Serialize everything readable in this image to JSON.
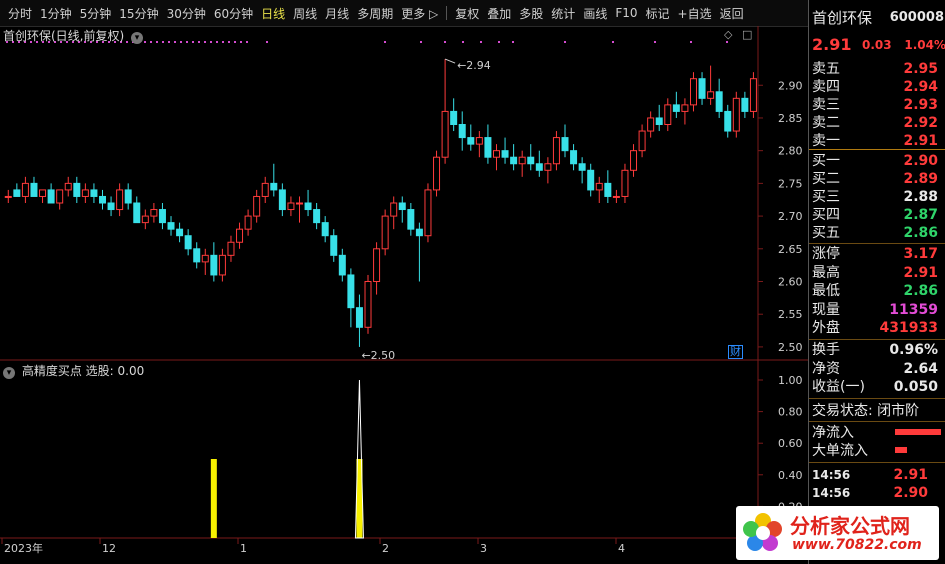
{
  "toolbar": {
    "items": [
      "分时",
      "1分钟",
      "5分钟",
      "15分钟",
      "30分钟",
      "60分钟",
      "日线",
      "周线",
      "月线",
      "多周期",
      "更多 ▷",
      "复权",
      "叠加",
      "多股",
      "统计",
      "画线",
      "F10",
      "标记",
      "+自选",
      "返回"
    ],
    "active_index": 6
  },
  "main_chart": {
    "title": "首创环保(日线,前复权)",
    "cai_badge": "财",
    "high_annotation": "2.94",
    "low_annotation": "2.50"
  },
  "indicator": {
    "title": "高精度买点 选股: 0.00"
  },
  "x_axis": {
    "labels": [
      "2023年",
      "12",
      "1",
      "2",
      "3",
      "4"
    ]
  },
  "right_panel": {
    "stock_name": "首创环保",
    "stock_code": "600008",
    "price": "2.91",
    "change": "0.03",
    "change_pct": "1.04%",
    "sell": [
      {
        "label": "卖五",
        "price": "2.95"
      },
      {
        "label": "卖四",
        "price": "2.94"
      },
      {
        "label": "卖三",
        "price": "2.93"
      },
      {
        "label": "卖二",
        "price": "2.92"
      },
      {
        "label": "卖一",
        "price": "2.91"
      }
    ],
    "buy": [
      {
        "label": "买一",
        "price": "2.90"
      },
      {
        "label": "买二",
        "price": "2.89"
      },
      {
        "label": "买三",
        "price": "2.88"
      },
      {
        "label": "买四",
        "price": "2.87"
      },
      {
        "label": "买五",
        "price": "2.86"
      }
    ],
    "stats": [
      {
        "label": "涨停",
        "value": "3.17"
      },
      {
        "label": "最高",
        "value": "2.91"
      },
      {
        "label": "最低",
        "value": "2.86"
      },
      {
        "label": "现量",
        "value": "11359"
      },
      {
        "label": "外盘",
        "value": "431933"
      }
    ],
    "extra": [
      {
        "label": "换手",
        "value": "0.96%"
      },
      {
        "label": "净资",
        "value": "2.64"
      },
      {
        "label": "收益(一)",
        "value": "0.050"
      }
    ],
    "trade_status": "交易状态: 闭市阶",
    "net_inflow": "净流入",
    "big_inflow": "大单流入",
    "ticks": [
      {
        "time": "14:56",
        "price": "2.91"
      },
      {
        "time": "14:56",
        "price": "2.90"
      }
    ]
  },
  "watermark": {
    "name": "分析家公式网",
    "url": "www.70822.com"
  },
  "colors": {
    "up": "#ff3b3b",
    "down": "#38e0e8",
    "signal": "#f7f000",
    "grid": "#7a1a1a"
  },
  "chart_data": [
    {
      "type": "candlestick",
      "title": "首创环保(日线,前复权)",
      "y_range": [
        2.48,
        2.96
      ],
      "y_ticks": [
        2.5,
        2.55,
        2.6,
        2.65,
        2.7,
        2.75,
        2.8,
        2.85,
        2.9
      ],
      "ohlc": [
        [
          2.73,
          2.74,
          2.72,
          2.73
        ],
        [
          2.74,
          2.75,
          2.73,
          2.73
        ],
        [
          2.73,
          2.76,
          2.72,
          2.75
        ],
        [
          2.75,
          2.76,
          2.73,
          2.73
        ],
        [
          2.73,
          2.74,
          2.72,
          2.74
        ],
        [
          2.74,
          2.75,
          2.73,
          2.72
        ],
        [
          2.72,
          2.74,
          2.71,
          2.74
        ],
        [
          2.74,
          2.76,
          2.73,
          2.75
        ],
        [
          2.75,
          2.76,
          2.72,
          2.73
        ],
        [
          2.73,
          2.75,
          2.72,
          2.74
        ],
        [
          2.74,
          2.75,
          2.72,
          2.73
        ],
        [
          2.73,
          2.74,
          2.71,
          2.72
        ],
        [
          2.72,
          2.73,
          2.7,
          2.71
        ],
        [
          2.71,
          2.75,
          2.7,
          2.74
        ],
        [
          2.74,
          2.75,
          2.71,
          2.72
        ],
        [
          2.72,
          2.73,
          2.69,
          2.69
        ],
        [
          2.69,
          2.71,
          2.68,
          2.7
        ],
        [
          2.7,
          2.72,
          2.69,
          2.71
        ],
        [
          2.71,
          2.72,
          2.68,
          2.69
        ],
        [
          2.69,
          2.7,
          2.67,
          2.68
        ],
        [
          2.68,
          2.69,
          2.66,
          2.67
        ],
        [
          2.67,
          2.68,
          2.64,
          2.65
        ],
        [
          2.65,
          2.66,
          2.62,
          2.63
        ],
        [
          2.63,
          2.65,
          2.61,
          2.64
        ],
        [
          2.64,
          2.66,
          2.6,
          2.61
        ],
        [
          2.61,
          2.65,
          2.6,
          2.64
        ],
        [
          2.64,
          2.67,
          2.63,
          2.66
        ],
        [
          2.66,
          2.69,
          2.65,
          2.68
        ],
        [
          2.68,
          2.71,
          2.67,
          2.7
        ],
        [
          2.7,
          2.74,
          2.69,
          2.73
        ],
        [
          2.73,
          2.76,
          2.72,
          2.75
        ],
        [
          2.75,
          2.78,
          2.73,
          2.74
        ],
        [
          2.74,
          2.75,
          2.7,
          2.71
        ],
        [
          2.71,
          2.73,
          2.7,
          2.72
        ],
        [
          2.72,
          2.73,
          2.69,
          2.72
        ],
        [
          2.72,
          2.74,
          2.7,
          2.71
        ],
        [
          2.71,
          2.72,
          2.68,
          2.69
        ],
        [
          2.69,
          2.7,
          2.66,
          2.67
        ],
        [
          2.67,
          2.68,
          2.63,
          2.64
        ],
        [
          2.64,
          2.65,
          2.6,
          2.61
        ],
        [
          2.61,
          2.62,
          2.53,
          2.56
        ],
        [
          2.56,
          2.58,
          2.5,
          2.53
        ],
        [
          2.53,
          2.61,
          2.52,
          2.6
        ],
        [
          2.6,
          2.66,
          2.58,
          2.65
        ],
        [
          2.65,
          2.71,
          2.64,
          2.7
        ],
        [
          2.7,
          2.73,
          2.68,
          2.72
        ],
        [
          2.72,
          2.73,
          2.69,
          2.71
        ],
        [
          2.71,
          2.72,
          2.67,
          2.68
        ],
        [
          2.68,
          2.69,
          2.6,
          2.67
        ],
        [
          2.67,
          2.75,
          2.66,
          2.74
        ],
        [
          2.74,
          2.8,
          2.73,
          2.79
        ],
        [
          2.79,
          2.94,
          2.78,
          2.86
        ],
        [
          2.86,
          2.88,
          2.83,
          2.84
        ],
        [
          2.84,
          2.86,
          2.8,
          2.82
        ],
        [
          2.82,
          2.84,
          2.8,
          2.81
        ],
        [
          2.81,
          2.83,
          2.79,
          2.82
        ],
        [
          2.82,
          2.84,
          2.78,
          2.79
        ],
        [
          2.79,
          2.81,
          2.77,
          2.8
        ],
        [
          2.8,
          2.82,
          2.78,
          2.79
        ],
        [
          2.79,
          2.81,
          2.77,
          2.78
        ],
        [
          2.78,
          2.8,
          2.76,
          2.79
        ],
        [
          2.79,
          2.81,
          2.77,
          2.78
        ],
        [
          2.78,
          2.8,
          2.76,
          2.77
        ],
        [
          2.77,
          2.79,
          2.75,
          2.78
        ],
        [
          2.78,
          2.83,
          2.77,
          2.82
        ],
        [
          2.82,
          2.84,
          2.79,
          2.8
        ],
        [
          2.8,
          2.81,
          2.77,
          2.78
        ],
        [
          2.78,
          2.79,
          2.75,
          2.77
        ],
        [
          2.77,
          2.78,
          2.73,
          2.74
        ],
        [
          2.74,
          2.76,
          2.72,
          2.75
        ],
        [
          2.75,
          2.77,
          2.72,
          2.73
        ],
        [
          2.73,
          2.74,
          2.72,
          2.73
        ],
        [
          2.73,
          2.78,
          2.72,
          2.77
        ],
        [
          2.77,
          2.81,
          2.76,
          2.8
        ],
        [
          2.8,
          2.84,
          2.79,
          2.83
        ],
        [
          2.83,
          2.86,
          2.82,
          2.85
        ],
        [
          2.85,
          2.87,
          2.83,
          2.84
        ],
        [
          2.84,
          2.88,
          2.83,
          2.87
        ],
        [
          2.87,
          2.89,
          2.85,
          2.86
        ],
        [
          2.86,
          2.88,
          2.84,
          2.87
        ],
        [
          2.87,
          2.92,
          2.86,
          2.91
        ],
        [
          2.91,
          2.92,
          2.87,
          2.88
        ],
        [
          2.88,
          2.93,
          2.87,
          2.89
        ],
        [
          2.89,
          2.91,
          2.85,
          2.86
        ],
        [
          2.86,
          2.87,
          2.82,
          2.83
        ],
        [
          2.83,
          2.89,
          2.82,
          2.88
        ],
        [
          2.88,
          2.89,
          2.85,
          2.86
        ],
        [
          2.86,
          2.92,
          2.85,
          2.91
        ]
      ]
    },
    {
      "type": "bar",
      "title": "高精度买点 选股: 0.00",
      "y_range": [
        0,
        1.0
      ],
      "y_ticks": [
        0.2,
        0.4,
        0.6,
        0.8,
        1.0
      ],
      "signals": [
        {
          "index": 24,
          "value": 0.5
        },
        {
          "index": 41,
          "value": 0.5
        },
        {
          "index": 41,
          "value": 1.0
        }
      ]
    }
  ]
}
